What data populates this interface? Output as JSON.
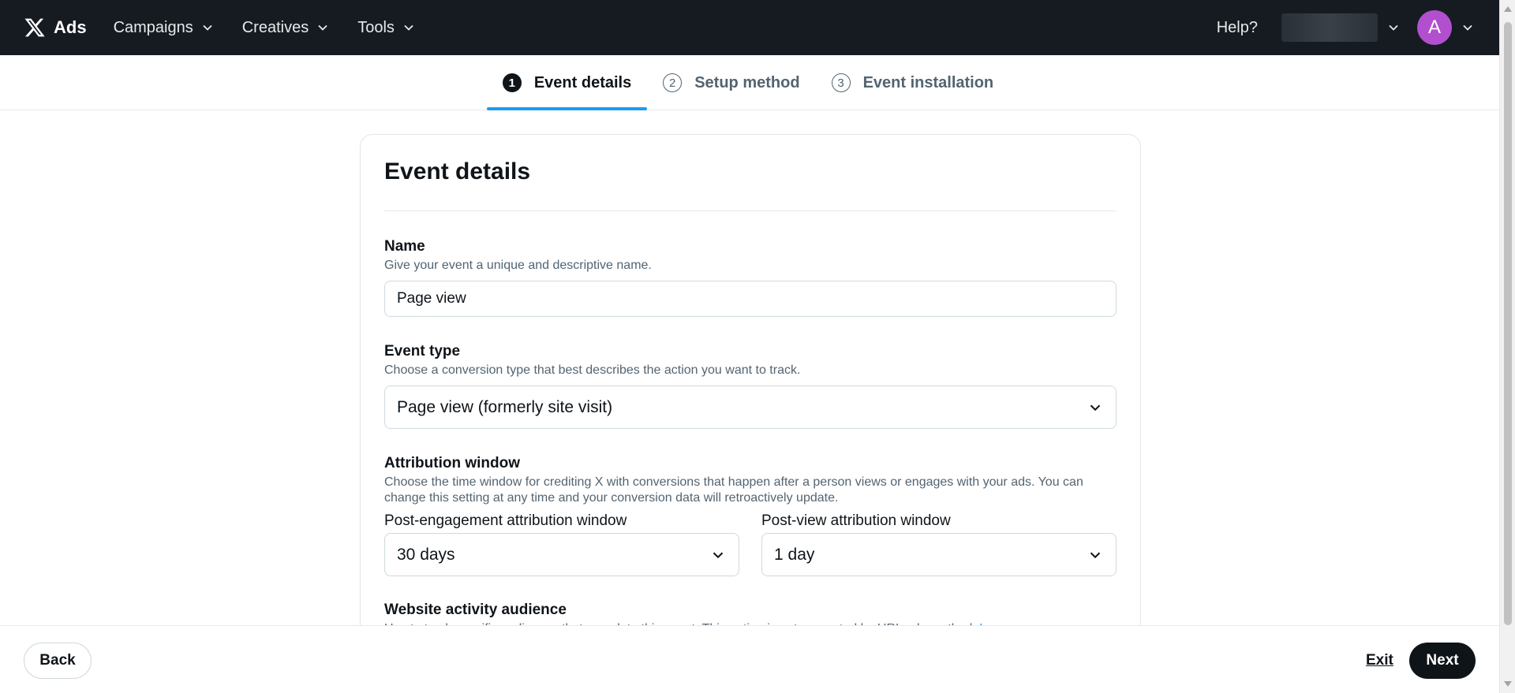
{
  "nav": {
    "brand": "Ads",
    "items": [
      {
        "label": "Campaigns"
      },
      {
        "label": "Creatives"
      },
      {
        "label": "Tools"
      }
    ],
    "help": "Help?",
    "avatar_letter": "A"
  },
  "stepper": {
    "steps": [
      {
        "number": "1",
        "label": "Event details",
        "active": true
      },
      {
        "number": "2",
        "label": "Setup method",
        "active": false
      },
      {
        "number": "3",
        "label": "Event installation",
        "active": false
      }
    ]
  },
  "form": {
    "title": "Event details",
    "name": {
      "label": "Name",
      "description": "Give your event a unique and descriptive name.",
      "value": "Page view"
    },
    "event_type": {
      "label": "Event type",
      "description": "Choose a conversion type that best describes the action you want to track.",
      "value": "Page view (formerly site visit)"
    },
    "attribution": {
      "label": "Attribution window",
      "description": "Choose the time window for crediting X with conversions that happen after a person views or engages with your ads. You can change this setting at any time and your conversion data will retroactively update.",
      "post_engagement_label": "Post-engagement attribution window",
      "post_engagement_value": "30 days",
      "post_view_label": "Post-view attribution window",
      "post_view_value": "1 day"
    },
    "audience": {
      "label": "Website activity audience",
      "description": "Use to track specific audiences that complete this event. This option is not supported by URL rule method.",
      "link": "Learn more"
    }
  },
  "footer": {
    "back": "Back",
    "exit": "Exit",
    "next": "Next"
  },
  "colors": {
    "nav_bg": "#161b22",
    "accent": "#1d9bf0",
    "avatar": "#b24fcf",
    "primary_button": "#0f1419"
  }
}
